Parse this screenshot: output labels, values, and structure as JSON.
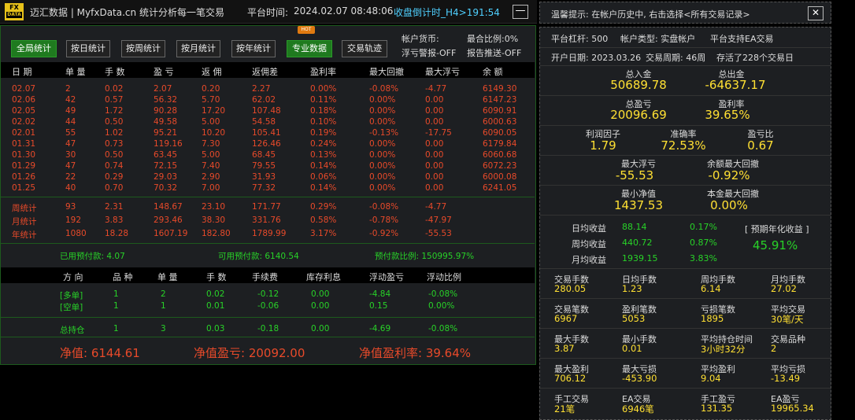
{
  "app": {
    "logo_top": "FX",
    "logo_bottom": "DATA",
    "title": "迈汇数据 | MyfxData.cn  统计分析每一笔交易",
    "time_label": "平台时间:",
    "time": "2024.02.07 08:48:06",
    "countdown": "收盘倒计时_H4>191:54",
    "minimize": "—"
  },
  "buttons": [
    "全局统计",
    "按日统计",
    "按周统计",
    "按月统计",
    "按年统计",
    "专业数据",
    "交易轨迹"
  ],
  "hot": "HOT",
  "account": {
    "currency": "帐户货币:",
    "margin": "最合比例:0%",
    "float_warn": "浮亏警报-OFF",
    "report": "报告推送-OFF"
  },
  "table": {
    "headers": [
      "日 期",
      "单 量",
      "手 数",
      "盈 亏",
      "返 佣",
      "返佣差",
      "盈利率",
      "最大回撤",
      "最大浮亏",
      "余 额"
    ],
    "rows": [
      [
        "02.07",
        "2",
        "0.02",
        "2.07",
        "0.20",
        "2.27",
        "0.00%",
        "-0.08%",
        "-4.77",
        "6149.30"
      ],
      [
        "02.06",
        "42",
        "0.57",
        "56.32",
        "5.70",
        "62.02",
        "0.11%",
        "0.00%",
        "0.00",
        "6147.23"
      ],
      [
        "02.05",
        "49",
        "1.72",
        "90.28",
        "17.20",
        "107.48",
        "0.18%",
        "0.00%",
        "0.00",
        "6090.91"
      ],
      [
        "02.02",
        "44",
        "0.50",
        "49.58",
        "5.00",
        "54.58",
        "0.10%",
        "0.00%",
        "0.00",
        "6000.63"
      ],
      [
        "02.01",
        "55",
        "1.02",
        "95.21",
        "10.20",
        "105.41",
        "0.19%",
        "-0.13%",
        "-17.75",
        "6090.05"
      ],
      [
        "01.31",
        "47",
        "0.73",
        "119.16",
        "7.30",
        "126.46",
        "0.24%",
        "0.00%",
        "0.00",
        "6179.84"
      ],
      [
        "01.30",
        "30",
        "0.50",
        "63.45",
        "5.00",
        "68.45",
        "0.13%",
        "0.00%",
        "0.00",
        "6060.68"
      ],
      [
        "01.29",
        "47",
        "0.74",
        "72.15",
        "7.40",
        "79.55",
        "0.14%",
        "0.00%",
        "0.00",
        "6072.23"
      ],
      [
        "01.26",
        "22",
        "0.29",
        "29.03",
        "2.90",
        "31.93",
        "0.06%",
        "0.00%",
        "0.00",
        "6000.08"
      ],
      [
        "01.25",
        "40",
        "0.70",
        "70.32",
        "7.00",
        "77.32",
        "0.14%",
        "0.00%",
        "0.00",
        "6241.05"
      ]
    ],
    "summary": [
      [
        "周统计",
        "93",
        "2.31",
        "148.67",
        "23.10",
        "171.77",
        "0.29%",
        "-0.08%",
        "-4.77"
      ],
      [
        "月统计",
        "192",
        "3.83",
        "293.46",
        "38.30",
        "331.76",
        "0.58%",
        "-0.78%",
        "-47.97"
      ],
      [
        "年统计",
        "1080",
        "18.28",
        "1607.19",
        "182.80",
        "1789.99",
        "3.17%",
        "-0.92%",
        "-55.53"
      ]
    ]
  },
  "funds": {
    "used": "已用预付款: 4.07",
    "free": "可用预付款: 6140.54",
    "ratio": "预付款比例: 150995.97%"
  },
  "positions": {
    "headers": [
      "方 向",
      "品 种",
      "单 量",
      "手 数",
      "手续费",
      "库存利息",
      "浮动盈亏",
      "浮动比例"
    ],
    "rows": [
      [
        "[多单]",
        "1",
        "2",
        "0.02",
        "-0.12",
        "0.00",
        "-4.84",
        "-0.08%"
      ],
      [
        "[空单]",
        "1",
        "1",
        "0.01",
        "-0.06",
        "0.00",
        "0.15",
        "0.00%"
      ]
    ],
    "total": [
      "总持仓",
      "1",
      "3",
      "0.03",
      "-0.18",
      "0.00",
      "-4.69",
      "-0.08%"
    ]
  },
  "equity": {
    "value": "净值: 6144.61",
    "profit": "净值盈亏: 20092.00",
    "rate": "净值盈利率: 39.64%"
  },
  "right": {
    "tip": "温馨提示: 在帐户历史中, 右击选择<所有交易记录>",
    "close": "✕",
    "leverage": "平台杠杆: 500",
    "acct_type": "帐户类型: 实盘帐户",
    "ea": "平台支持EA交易",
    "open_date": "开户日期: 2023.03.26",
    "period": "交易周期: 46周",
    "alive": "存活了228个交易日",
    "deposit_l": "总入金",
    "deposit": "50689.78",
    "withdraw_l": "总出金",
    "withdraw": "-64637.17",
    "pnl_l": "总盈亏",
    "pnl": "20096.69",
    "profit_rate_l": "盈利率",
    "profit_rate": "39.65%",
    "pf_l": "利润因子",
    "pf": "1.79",
    "acc_l": "准确率",
    "acc": "72.53%",
    "ratio_l": "盈亏比",
    "ratio": "0.67",
    "maxfloat_l": "最大浮亏",
    "maxfloat": "-55.53",
    "maxdd_l": "余额最大回撤",
    "maxdd": "-0.92%",
    "mineq_l": "最小净值",
    "mineq": "1437.53",
    "capdd_l": "本金最大回撤",
    "capdd": "0.00%",
    "daily_l": "日均收益",
    "daily": "88.14",
    "daily_p": "0.17%",
    "weekly_l": "周均收益",
    "weekly": "440.72",
    "weekly_p": "0.87%",
    "monthly_l": "月均收益",
    "monthly": "1939.15",
    "monthly_p": "3.83%",
    "annual_l": "[ 预期年化收益 ]",
    "annual": "45.91%",
    "stats": [
      [
        [
          "交易手数",
          "280.05"
        ],
        [
          "日均手数",
          "1.23"
        ],
        [
          "周均手数",
          "6.14"
        ],
        [
          "月均手数",
          "27.02"
        ]
      ],
      [
        [
          "交易笔数",
          "6967"
        ],
        [
          "盈利笔数",
          "5053"
        ],
        [
          "亏损笔数",
          "1895"
        ],
        [
          "平均交易",
          "30笔/天"
        ]
      ],
      [
        [
          "最大手数",
          "3.87"
        ],
        [
          "最小手数",
          "0.01"
        ],
        [
          "平均持仓时间",
          "3小时32分"
        ],
        [
          "交易品种",
          "2"
        ]
      ],
      [
        [
          "最大盈利",
          "706.12"
        ],
        [
          "最大亏损",
          "-453.90"
        ],
        [
          "平均盈利",
          "9.04"
        ],
        [
          "平均亏损",
          "-13.49"
        ]
      ],
      [
        [
          "手工交易",
          "21笔"
        ],
        [
          "EA交易",
          "6946笔"
        ],
        [
          "手工盈亏",
          "131.35"
        ],
        [
          "EA盈亏",
          "19965.34"
        ]
      ]
    ]
  }
}
